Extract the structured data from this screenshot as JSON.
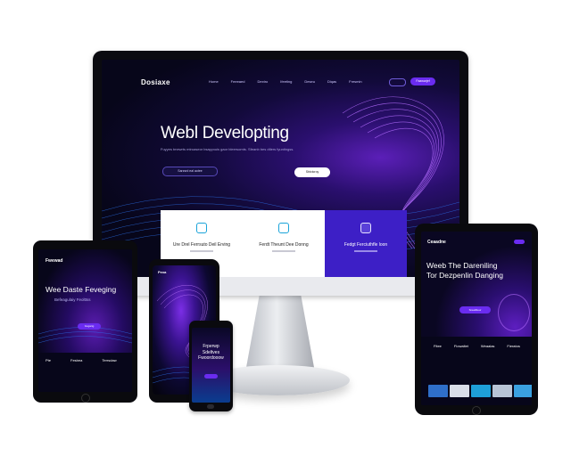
{
  "monitor": {
    "logo": "Dosiaxe",
    "nav": [
      "Home",
      "Feeeaed",
      "Dextro",
      "Ifeeting",
      "Deseu",
      "Diqas",
      "Fresmin"
    ],
    "cta": "Faawarjef",
    "hero_title": "Webl Developting",
    "hero_sub": "Fuyyes tmewrts mtroaseor bsayyouis gaor bleersomts. Sfeanb bes dtlers fyuntingss.",
    "btn_primary": "Sarzsrd eal aotee",
    "btn_secondary": "Sbtctcroy",
    "cards": [
      {
        "title": "Ure Drel Ferrsuto Deil Erving"
      },
      {
        "title": "Ferdt Theunt Dee Donng"
      },
      {
        "title": "Fedgt Ferciuthfle loon"
      }
    ]
  },
  "tablet_left": {
    "logo": "Fwewad",
    "headline": "Wee Daste Feveging",
    "subhead": "Befeagulaiy Feolttss",
    "button": "Gsgarig",
    "col_labels": [
      "Pte",
      "Fesbea",
      "Terrsdaw"
    ]
  },
  "phone_mid": {
    "logo": "Pexa"
  },
  "phone_small": {
    "lines": [
      "Frperwp",
      "Sdeltves",
      "Fwoordooow"
    ]
  },
  "tablet_right": {
    "logo": "Ceaadne",
    "headline_1": "Weeb The Dareniling",
    "headline_2": "Tor Dezpenlin Danging",
    "button": "Sreaifdeur",
    "col_labels": [
      "Fitee",
      "Fiowaltet",
      "Weaalas",
      "Fieratos"
    ]
  },
  "colors": {
    "accent": "#6a2cf0",
    "deep": "#07061a",
    "card_active": "#3d1fc6"
  }
}
